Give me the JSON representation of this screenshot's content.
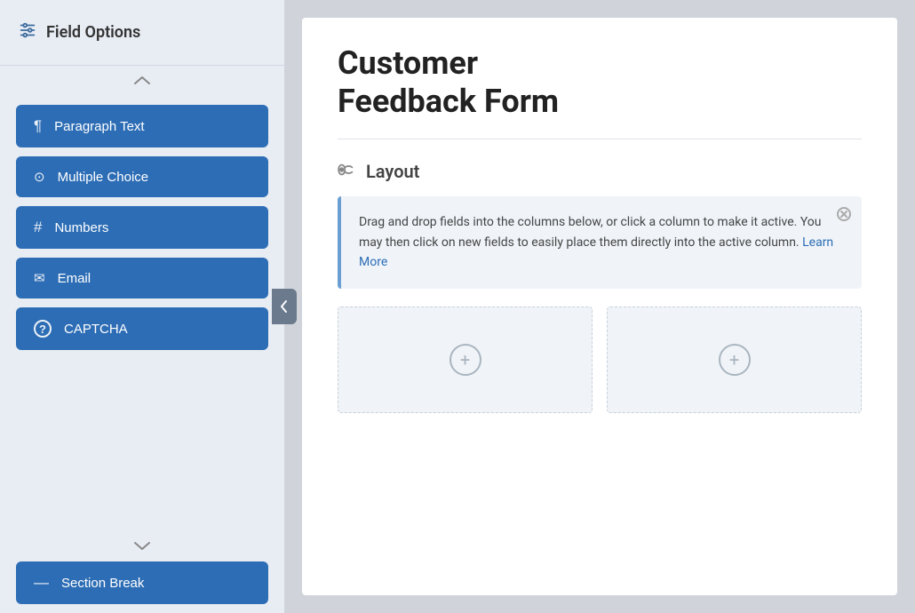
{
  "sidebar": {
    "header": {
      "title": "Field Options",
      "icon": "sliders-icon"
    },
    "scroll_up_label": "scroll up",
    "scroll_down_label": "scroll down",
    "fields": [
      {
        "id": "paragraph-text",
        "label": "Paragraph Text",
        "icon": "¶"
      },
      {
        "id": "multiple-choice",
        "label": "Multiple Choice",
        "icon": "⊙"
      },
      {
        "id": "numbers",
        "label": "Numbers",
        "icon": "#"
      },
      {
        "id": "email",
        "label": "Email",
        "icon": "✉"
      },
      {
        "id": "captcha",
        "label": "CAPTCHA",
        "icon": "?"
      }
    ],
    "bottom_field": {
      "label": "Section Break",
      "icon": "—"
    }
  },
  "main": {
    "form_title_line1": "Customer",
    "form_title_line2": "Feedback Form",
    "layout_section_title": "Layout",
    "info_box": {
      "text": "Drag and drop fields into the columns below, or click a column to make it active. You may then click on new fields to easily place them directly into the active column.",
      "link_text": "Learn More",
      "link_href": "#"
    },
    "columns": [
      {
        "id": "column-1",
        "label": "Add Field"
      },
      {
        "id": "column-2",
        "label": "Add Field"
      }
    ]
  },
  "colors": {
    "btn_bg": "#2d6db5",
    "sidebar_bg": "#e8edf4",
    "info_border": "#6b9fd4"
  }
}
